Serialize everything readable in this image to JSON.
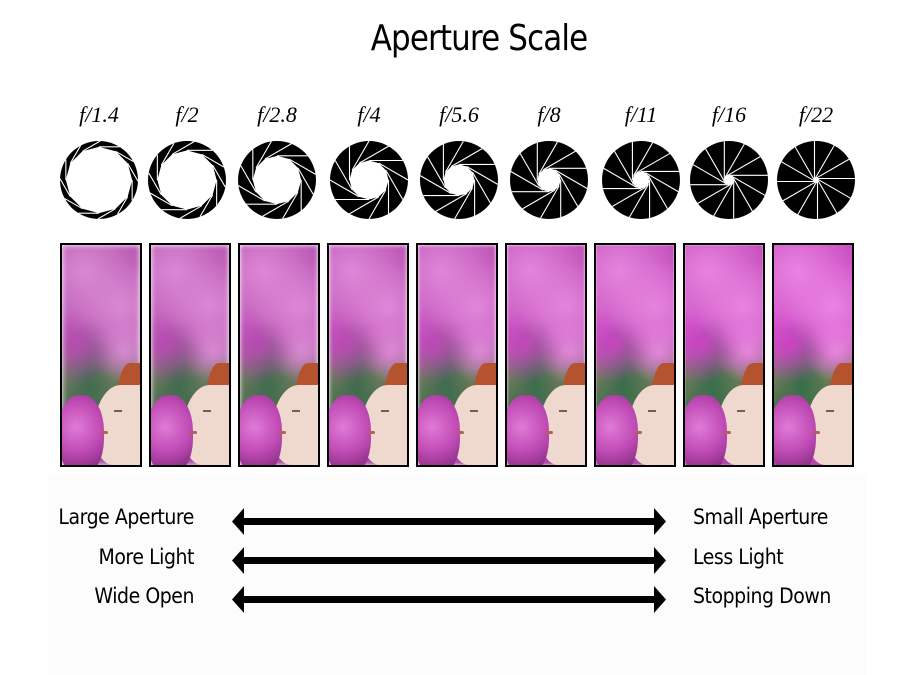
{
  "title": "Aperture Scale",
  "stops": [
    {
      "label": "f/1.4",
      "opening": 0.85,
      "blur": 1.0
    },
    {
      "label": "f/2",
      "opening": 0.76,
      "blur": 0.9
    },
    {
      "label": "f/2.8",
      "opening": 0.62,
      "blur": 0.8
    },
    {
      "label": "f/4",
      "opening": 0.5,
      "blur": 0.7
    },
    {
      "label": "f/5.6",
      "opening": 0.4,
      "blur": 0.6
    },
    {
      "label": "f/8",
      "opening": 0.3,
      "blur": 0.45
    },
    {
      "label": "f/11",
      "opening": 0.22,
      "blur": 0.3
    },
    {
      "label": "f/16",
      "opening": 0.12,
      "blur": 0.15
    },
    {
      "label": "f/22",
      "opening": 0.03,
      "blur": 0.0
    }
  ],
  "comparisons": [
    {
      "left": "Large Aperture",
      "right": "Small Aperture"
    },
    {
      "left": "More Light",
      "right": "Less Light"
    },
    {
      "left": "Wide Open",
      "right": "Stopping Down"
    }
  ],
  "colors": {
    "ink": "#000000",
    "flower": "#b64bb0",
    "flower_light": "#d98ad3",
    "leaf": "#3f6b4e",
    "hair": "#b5532e",
    "skin": "#efd9cf"
  }
}
